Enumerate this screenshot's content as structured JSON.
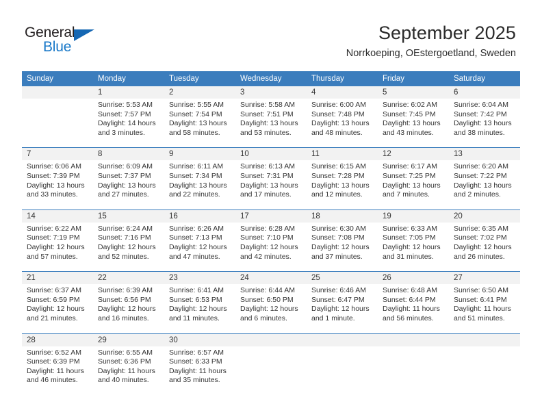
{
  "brand": {
    "name_dark": "General",
    "name_blue": "Blue",
    "accent_color": "#1878c8",
    "triangle_color": "#1567b3"
  },
  "header": {
    "title": "September 2025",
    "subtitle": "Norrkoeping, OEstergoetland, Sweden"
  },
  "calendar": {
    "header_bg": "#3b7dbd",
    "daynum_bg": "#f2f2f2",
    "separator_color": "#3b7dbd",
    "weekdays": [
      "Sunday",
      "Monday",
      "Tuesday",
      "Wednesday",
      "Thursday",
      "Friday",
      "Saturday"
    ],
    "weeks": [
      [
        {
          "day": "",
          "sunrise": "",
          "sunset": "",
          "daylight1": "",
          "daylight2": ""
        },
        {
          "day": "1",
          "sunrise": "Sunrise: 5:53 AM",
          "sunset": "Sunset: 7:57 PM",
          "daylight1": "Daylight: 14 hours",
          "daylight2": "and 3 minutes."
        },
        {
          "day": "2",
          "sunrise": "Sunrise: 5:55 AM",
          "sunset": "Sunset: 7:54 PM",
          "daylight1": "Daylight: 13 hours",
          "daylight2": "and 58 minutes."
        },
        {
          "day": "3",
          "sunrise": "Sunrise: 5:58 AM",
          "sunset": "Sunset: 7:51 PM",
          "daylight1": "Daylight: 13 hours",
          "daylight2": "and 53 minutes."
        },
        {
          "day": "4",
          "sunrise": "Sunrise: 6:00 AM",
          "sunset": "Sunset: 7:48 PM",
          "daylight1": "Daylight: 13 hours",
          "daylight2": "and 48 minutes."
        },
        {
          "day": "5",
          "sunrise": "Sunrise: 6:02 AM",
          "sunset": "Sunset: 7:45 PM",
          "daylight1": "Daylight: 13 hours",
          "daylight2": "and 43 minutes."
        },
        {
          "day": "6",
          "sunrise": "Sunrise: 6:04 AM",
          "sunset": "Sunset: 7:42 PM",
          "daylight1": "Daylight: 13 hours",
          "daylight2": "and 38 minutes."
        }
      ],
      [
        {
          "day": "7",
          "sunrise": "Sunrise: 6:06 AM",
          "sunset": "Sunset: 7:39 PM",
          "daylight1": "Daylight: 13 hours",
          "daylight2": "and 33 minutes."
        },
        {
          "day": "8",
          "sunrise": "Sunrise: 6:09 AM",
          "sunset": "Sunset: 7:37 PM",
          "daylight1": "Daylight: 13 hours",
          "daylight2": "and 27 minutes."
        },
        {
          "day": "9",
          "sunrise": "Sunrise: 6:11 AM",
          "sunset": "Sunset: 7:34 PM",
          "daylight1": "Daylight: 13 hours",
          "daylight2": "and 22 minutes."
        },
        {
          "day": "10",
          "sunrise": "Sunrise: 6:13 AM",
          "sunset": "Sunset: 7:31 PM",
          "daylight1": "Daylight: 13 hours",
          "daylight2": "and 17 minutes."
        },
        {
          "day": "11",
          "sunrise": "Sunrise: 6:15 AM",
          "sunset": "Sunset: 7:28 PM",
          "daylight1": "Daylight: 13 hours",
          "daylight2": "and 12 minutes."
        },
        {
          "day": "12",
          "sunrise": "Sunrise: 6:17 AM",
          "sunset": "Sunset: 7:25 PM",
          "daylight1": "Daylight: 13 hours",
          "daylight2": "and 7 minutes."
        },
        {
          "day": "13",
          "sunrise": "Sunrise: 6:20 AM",
          "sunset": "Sunset: 7:22 PM",
          "daylight1": "Daylight: 13 hours",
          "daylight2": "and 2 minutes."
        }
      ],
      [
        {
          "day": "14",
          "sunrise": "Sunrise: 6:22 AM",
          "sunset": "Sunset: 7:19 PM",
          "daylight1": "Daylight: 12 hours",
          "daylight2": "and 57 minutes."
        },
        {
          "day": "15",
          "sunrise": "Sunrise: 6:24 AM",
          "sunset": "Sunset: 7:16 PM",
          "daylight1": "Daylight: 12 hours",
          "daylight2": "and 52 minutes."
        },
        {
          "day": "16",
          "sunrise": "Sunrise: 6:26 AM",
          "sunset": "Sunset: 7:13 PM",
          "daylight1": "Daylight: 12 hours",
          "daylight2": "and 47 minutes."
        },
        {
          "day": "17",
          "sunrise": "Sunrise: 6:28 AM",
          "sunset": "Sunset: 7:10 PM",
          "daylight1": "Daylight: 12 hours",
          "daylight2": "and 42 minutes."
        },
        {
          "day": "18",
          "sunrise": "Sunrise: 6:30 AM",
          "sunset": "Sunset: 7:08 PM",
          "daylight1": "Daylight: 12 hours",
          "daylight2": "and 37 minutes."
        },
        {
          "day": "19",
          "sunrise": "Sunrise: 6:33 AM",
          "sunset": "Sunset: 7:05 PM",
          "daylight1": "Daylight: 12 hours",
          "daylight2": "and 31 minutes."
        },
        {
          "day": "20",
          "sunrise": "Sunrise: 6:35 AM",
          "sunset": "Sunset: 7:02 PM",
          "daylight1": "Daylight: 12 hours",
          "daylight2": "and 26 minutes."
        }
      ],
      [
        {
          "day": "21",
          "sunrise": "Sunrise: 6:37 AM",
          "sunset": "Sunset: 6:59 PM",
          "daylight1": "Daylight: 12 hours",
          "daylight2": "and 21 minutes."
        },
        {
          "day": "22",
          "sunrise": "Sunrise: 6:39 AM",
          "sunset": "Sunset: 6:56 PM",
          "daylight1": "Daylight: 12 hours",
          "daylight2": "and 16 minutes."
        },
        {
          "day": "23",
          "sunrise": "Sunrise: 6:41 AM",
          "sunset": "Sunset: 6:53 PM",
          "daylight1": "Daylight: 12 hours",
          "daylight2": "and 11 minutes."
        },
        {
          "day": "24",
          "sunrise": "Sunrise: 6:44 AM",
          "sunset": "Sunset: 6:50 PM",
          "daylight1": "Daylight: 12 hours",
          "daylight2": "and 6 minutes."
        },
        {
          "day": "25",
          "sunrise": "Sunrise: 6:46 AM",
          "sunset": "Sunset: 6:47 PM",
          "daylight1": "Daylight: 12 hours",
          "daylight2": "and 1 minute."
        },
        {
          "day": "26",
          "sunrise": "Sunrise: 6:48 AM",
          "sunset": "Sunset: 6:44 PM",
          "daylight1": "Daylight: 11 hours",
          "daylight2": "and 56 minutes."
        },
        {
          "day": "27",
          "sunrise": "Sunrise: 6:50 AM",
          "sunset": "Sunset: 6:41 PM",
          "daylight1": "Daylight: 11 hours",
          "daylight2": "and 51 minutes."
        }
      ],
      [
        {
          "day": "28",
          "sunrise": "Sunrise: 6:52 AM",
          "sunset": "Sunset: 6:39 PM",
          "daylight1": "Daylight: 11 hours",
          "daylight2": "and 46 minutes."
        },
        {
          "day": "29",
          "sunrise": "Sunrise: 6:55 AM",
          "sunset": "Sunset: 6:36 PM",
          "daylight1": "Daylight: 11 hours",
          "daylight2": "and 40 minutes."
        },
        {
          "day": "30",
          "sunrise": "Sunrise: 6:57 AM",
          "sunset": "Sunset: 6:33 PM",
          "daylight1": "Daylight: 11 hours",
          "daylight2": "and 35 minutes."
        },
        {
          "day": "",
          "sunrise": "",
          "sunset": "",
          "daylight1": "",
          "daylight2": ""
        },
        {
          "day": "",
          "sunrise": "",
          "sunset": "",
          "daylight1": "",
          "daylight2": ""
        },
        {
          "day": "",
          "sunrise": "",
          "sunset": "",
          "daylight1": "",
          "daylight2": ""
        },
        {
          "day": "",
          "sunrise": "",
          "sunset": "",
          "daylight1": "",
          "daylight2": ""
        }
      ]
    ]
  }
}
